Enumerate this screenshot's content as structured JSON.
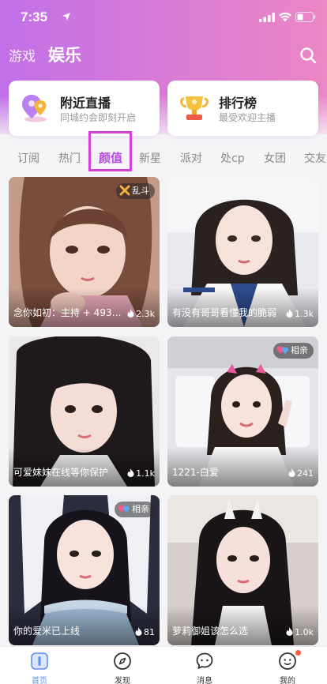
{
  "status_bar": {
    "time": "7:35"
  },
  "top_tabs": {
    "games": "游戏",
    "entertainment": "娱乐"
  },
  "feature_cards": [
    {
      "title": "附近直播",
      "subtitle": "同城约会即刻开启",
      "icon": "location-pin-icon"
    },
    {
      "title": "排行榜",
      "subtitle": "最受欢迎主播",
      "icon": "trophy-icon"
    }
  ],
  "category_tabs": [
    "订阅",
    "热门",
    "颜值",
    "新星",
    "派对",
    "处cp",
    "女团",
    "交友"
  ],
  "active_category": "颜值",
  "streams": [
    {
      "title": "念你如初：主持 + 49330...",
      "heat": "2.3k",
      "badge": "乱斗"
    },
    {
      "title": "有没有哥哥看懂我的脆弱",
      "heat": "1.3k",
      "badge": ""
    },
    {
      "title": "可爱妹妹在线等你保护",
      "heat": "1.1k",
      "badge": ""
    },
    {
      "title": "1221-白爱",
      "heat": "241",
      "badge": "相亲"
    },
    {
      "title": "你的爱米已上线",
      "heat": "81",
      "badge": "相亲"
    },
    {
      "title": "萝莉御姐该怎么选",
      "heat": "1.0k",
      "badge": ""
    }
  ],
  "bottom_nav": [
    {
      "label": "首页",
      "icon": "home-icon",
      "active": true
    },
    {
      "label": "发现",
      "icon": "compass-icon",
      "active": false
    },
    {
      "label": "消息",
      "icon": "chat-icon",
      "active": false
    },
    {
      "label": "我的",
      "icon": "profile-icon",
      "active": false
    }
  ],
  "colors": {
    "header_gradient_start": "#c070e8",
    "header_gradient_end": "#ec86c6",
    "active_tab": "#b54ae0",
    "highlight_box": "#d440d8",
    "nav_active": "#5b8ff0",
    "notification_dot": "#ff5a3c"
  }
}
